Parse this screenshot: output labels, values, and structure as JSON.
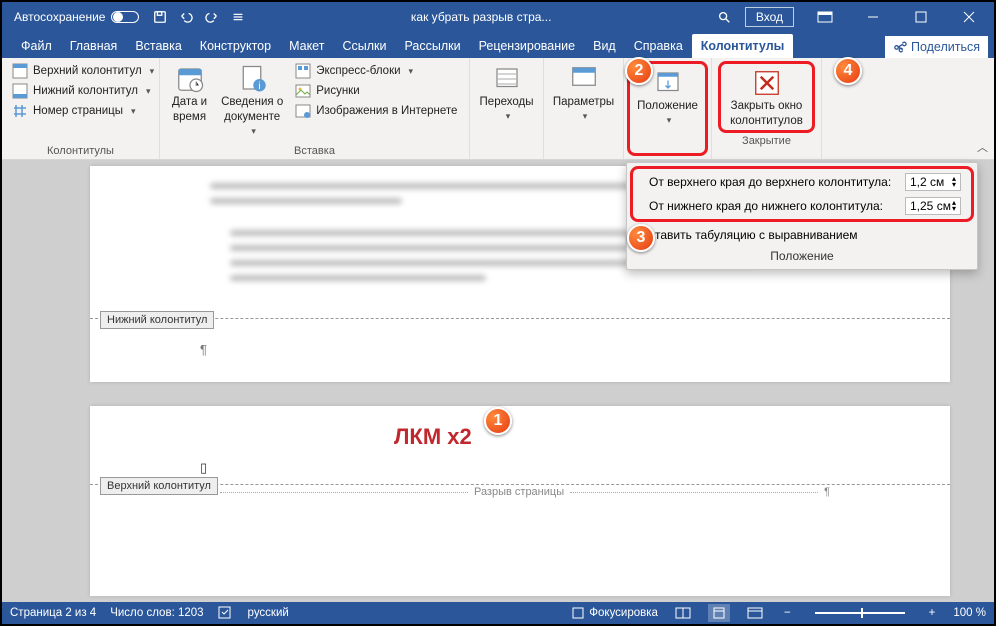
{
  "titlebar": {
    "autosave": "Автосохранение",
    "title": "как убрать разрыв стра...",
    "login": "Вход"
  },
  "tabs": {
    "file": "Файл",
    "home": "Главная",
    "insert": "Вставка",
    "design": "Конструктор",
    "layout": "Макет",
    "references": "Ссылки",
    "mailings": "Рассылки",
    "review": "Рецензирование",
    "view": "Вид",
    "help": "Справка",
    "headerfooter": "Колонтитулы",
    "share": "Поделиться"
  },
  "ribbon": {
    "group_hf": "Колонтитулы",
    "header": "Верхний колонтитул",
    "footer": "Нижний колонтитул",
    "pagenum": "Номер страницы",
    "group_insert": "Вставка",
    "datetime1": "Дата и",
    "datetime2": "время",
    "docinfo1": "Сведения о",
    "docinfo2": "документе",
    "quickparts": "Экспресс-блоки",
    "pictures": "Рисунки",
    "onlinepics": "Изображения в Интернете",
    "transitions": "Переходы",
    "parameters": "Параметры",
    "position": "Положение",
    "close1": "Закрыть окно",
    "close2": "колонтитулов",
    "group_close": "Закрытие"
  },
  "panel": {
    "top_label": "От верхнего края до верхнего колонтитула:",
    "top_val": "1,2 см",
    "bottom_label": "От нижнего края до нижнего колонтитула:",
    "bottom_val": "1,25 см",
    "tab_align": "Вставить табуляцию с выравниванием",
    "foot": "Положение"
  },
  "doc": {
    "footer_tag": "Нижний колонтитул",
    "header_tag": "Верхний колонтитул",
    "page_break": "Разрыв страницы",
    "lkm": "ЛКМ x2"
  },
  "status": {
    "page": "Страница 2 из 4",
    "words": "Число слов: 1203",
    "lang": "русский",
    "focus": "Фокусировка",
    "zoom": "100 %"
  },
  "badges": {
    "b1": "1",
    "b2": "2",
    "b3": "3",
    "b4": "4"
  }
}
